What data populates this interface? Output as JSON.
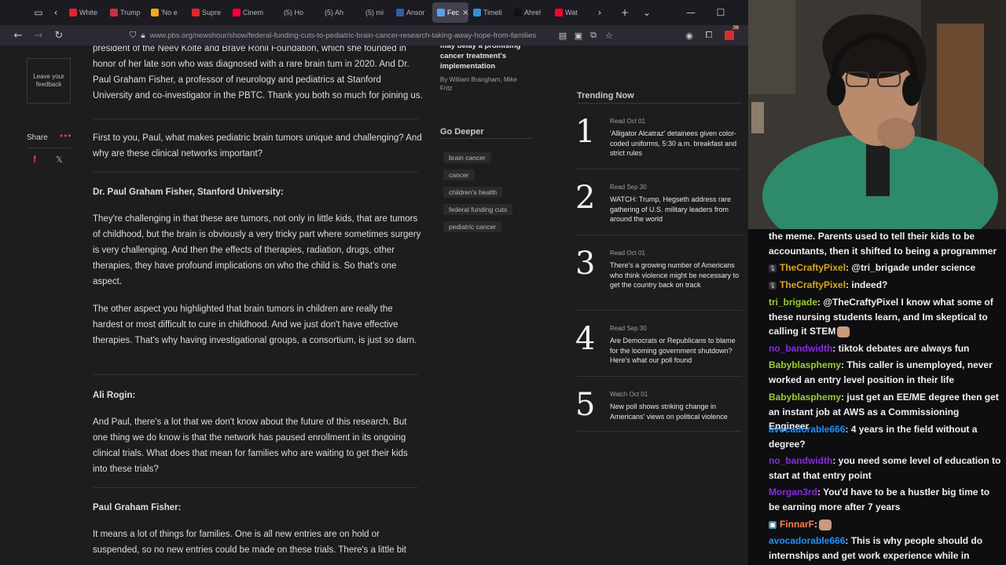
{
  "browser": {
    "tabs": [
      {
        "label": "White",
        "icon": "ap-icon",
        "color": "#e4252b",
        "active": false
      },
      {
        "label": "Trump",
        "icon": "ring-icon",
        "color": "#c8323c",
        "active": false
      },
      {
        "label": "'No e",
        "icon": "nbc-icon",
        "color": "#f5a623",
        "active": false
      },
      {
        "label": "Supre",
        "icon": "ap-icon",
        "color": "#e4252b",
        "active": false
      },
      {
        "label": "Cinem",
        "icon": "youtube-icon",
        "color": "#ff0033",
        "active": false
      },
      {
        "label": "(5) Ho",
        "icon": "x-icon",
        "color": "#1c1b22",
        "active": false
      },
      {
        "label": "(5) Ah",
        "icon": "x-icon",
        "color": "#1c1b22",
        "active": false
      },
      {
        "label": "(5) mi",
        "icon": "x-icon",
        "color": "#1c1b22",
        "active": false
      },
      {
        "label": "Ansor",
        "icon": "news-icon",
        "color": "#2d5fa8",
        "active": false
      },
      {
        "label": "Fec",
        "icon": "pbs-icon",
        "color": "#5aa0e8",
        "active": true
      },
      {
        "label": "Timeli",
        "icon": "globe-icon",
        "color": "#2f8fdd",
        "active": false
      },
      {
        "label": "Ahrel",
        "icon": "tiktok-icon",
        "color": "#111111",
        "active": false
      },
      {
        "label": "Wat",
        "icon": "youtube-icon",
        "color": "#ff0033",
        "active": false
      }
    ],
    "url": "www.pbs.org/newshour/show/federal-funding-cuts-to-pediatric-brain-cancer-research-taking-away-hope-from-families",
    "ext_badge": "36"
  },
  "sidebar": {
    "feedback": "Leave your feedback",
    "share": "Share",
    "more": "•••",
    "facebook": "f",
    "x": "𝕏"
  },
  "article": {
    "paragraphs": [
      {
        "speaker": "",
        "text": "president of the Neev Kolte and Brave Ronil Foundation, which she founded in honor of her late son who was diagnosed with a rare brain tum in 2020. And Dr. Paul Graham Fisher, a professor of neurology and pediatrics at Stanford University and co-investigator in the PBTC. Thank you both so much for joining us."
      },
      {
        "speaker": "",
        "text": "First to you, Paul, what makes pediatric brain tumors unique and challenging? And why are these clinical networks important?"
      },
      {
        "speaker": "Dr. Paul Graham Fisher, Stanford University:",
        "text": ""
      },
      {
        "speaker": "",
        "text": "They're challenging in that these are tumors, not only in little kids, that are tumors of childhood, but the brain is obviously a very tricky part where sometimes surgery is very challenging. And then the effects of therapies, radiation, drugs, other therapies, they have profound implications on who the child is. So that's one aspect."
      },
      {
        "speaker": "",
        "text": "The other aspect you highlighted that brain tumors in children are really the hardest or most difficult to cure in childhood. And we just don't have effective therapies. That's why having investigational groups, a consortium, is just so darn."
      },
      {
        "speaker": "Ali Rogin:",
        "text": ""
      },
      {
        "speaker": "",
        "text": "And Paul, there's a lot that we don't know about the future of this research. But one thing we do know is that the network has paused enrollment in its ongoing clinical trials. What does that mean for families who are waiting to get their kids into these trials?"
      },
      {
        "speaker": "Paul Graham Fisher:",
        "text": ""
      },
      {
        "speaker": "",
        "text": "It means a lot of things for families. One is all new entries are on hold or suspended, so no new entries could be made on these trials. There's a little bit"
      }
    ]
  },
  "related": {
    "title": "may delay a promising cancer treatment's implementation",
    "byline": "By William Brangham, Mike Fritz"
  },
  "go_deeper": {
    "title": "Go Deeper",
    "tags": [
      "brain cancer",
      "cancer",
      "children's health",
      "federal funding cuts",
      "pediatric cancer"
    ]
  },
  "trending": {
    "title": "Trending Now",
    "items": [
      {
        "num": "1",
        "meta": "Read Oct 01",
        "headline": "'Alligator Alcatraz' detainees given color-coded uniforms, 5:30 a.m. breakfast and strict rules"
      },
      {
        "num": "2",
        "meta": "Read Sep 30",
        "headline": "WATCH: Trump, Hegseth address rare gathering of U.S. military leaders from around the world"
      },
      {
        "num": "3",
        "meta": "Read Oct 01",
        "headline": "There's a growing number of Americans who think violence might be necessary to get the country back on track"
      },
      {
        "num": "4",
        "meta": "Read Sep 30",
        "headline": "Are Democrats or Republicans to blame for the looming government shutdown? Here's what our poll found"
      },
      {
        "num": "5",
        "meta": "Watch Oct 01",
        "headline": "New poll shows striking change in Americans' views on political violence"
      }
    ]
  },
  "chat": {
    "messages": [
      {
        "user": "",
        "color": "#efeff1",
        "badge": "",
        "text": "the meme. Parents used to tell their kids to be accountants, then it shifted to being a programmer"
      },
      {
        "user": "TheCraftyPixel",
        "color": "#daa520",
        "badge": "mic",
        "text": ": @tri_brigade under science"
      },
      {
        "user": "TheCraftyPixel",
        "color": "#daa520",
        "badge": "mic",
        "text": ": indeed?"
      },
      {
        "user": "tri_brigade",
        "color": "#9acd32",
        "badge": "",
        "text": ": @TheCraftyPixel I know what some of these nursing students learn, and Im skeptical to calling it STEM",
        "emote": true
      },
      {
        "user": "no_bandwidth",
        "color": "#8a2be2",
        "badge": "",
        "text": ": tiktok debates are always fun"
      },
      {
        "user": "Babyblasphemy",
        "color": "#9acd32",
        "badge": "",
        "text": ": This caller is unemployed, never worked an entry level position in their life"
      },
      {
        "user": "Babyblasphemy",
        "color": "#9acd32",
        "badge": "",
        "text": ": just get an EE/ME degree then get an instant job at AWS as a Commissioning Engineer"
      },
      {
        "user": "avocadorable666",
        "color": "#1e90ff",
        "badge": "",
        "text": ": 4 years in the field without a degree?"
      },
      {
        "user": "no_bandwidth",
        "color": "#8a2be2",
        "badge": "",
        "text": ": you need some level of education to start at that entry point"
      },
      {
        "user": "Morgan3rd",
        "color": "#8a2be2",
        "badge": "",
        "text": ": You'd have to be a hustler big time to be earning more after 7 years"
      },
      {
        "user": "FinnarF",
        "color": "#ff7f50",
        "badge": "sub",
        "text": ":",
        "emote": true
      },
      {
        "user": "avocadorable666",
        "color": "#1e90ff",
        "badge": "",
        "text": ": This is why people should do internships and get work experience while in college"
      }
    ]
  }
}
